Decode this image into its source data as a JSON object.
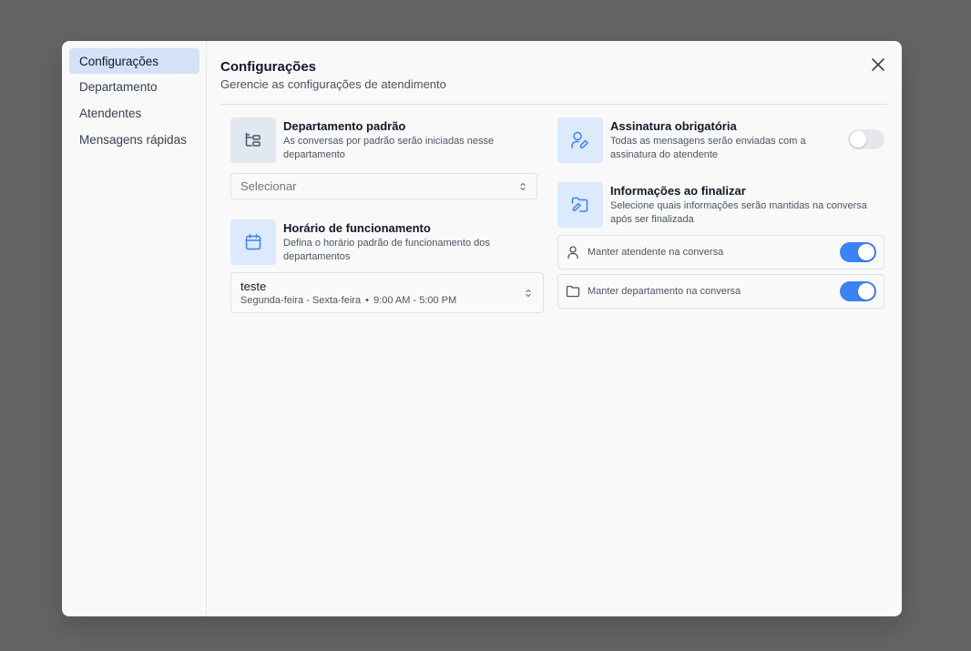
{
  "sidebar": {
    "items": [
      {
        "label": "Configurações"
      },
      {
        "label": "Departamento"
      },
      {
        "label": "Atendentes"
      },
      {
        "label": "Mensagens rápidas"
      }
    ]
  },
  "header": {
    "title": "Configurações",
    "subtitle": "Gerencie as configurações de atendimento"
  },
  "default_department": {
    "title": "Departamento padrão",
    "description": "As conversas por padrão serão iniciadas nesse departamento",
    "select_placeholder": "Selecionar",
    "icon": "department-tree-icon"
  },
  "business_hours": {
    "title": "Horário de funcionamento",
    "description": "Defina o horário padrão de funcionamento dos departamentos",
    "selected_name": "teste",
    "selected_days": "Segunda-feira - Sexta-feira",
    "separator": "•",
    "selected_hours": "9:00 AM - 5:00 PM",
    "icon": "calendar-icon"
  },
  "signature": {
    "title": "Assinatura obrigatória",
    "description": "Todas as mensagens serão enviadas com a assinatura do atendente",
    "enabled": false,
    "icon": "user-pen-icon"
  },
  "finalize_info": {
    "title": "Informações ao finalizar",
    "description": "Selecione quais informações serão mantidas na conversa após ser finalizada",
    "icon": "folder-pen-icon",
    "options": [
      {
        "label": "Manter atendente na conversa",
        "icon": "user-icon",
        "enabled": true
      },
      {
        "label": "Manter departamento na conversa",
        "icon": "folder-icon",
        "enabled": true
      }
    ]
  },
  "colors": {
    "accent": "#3b82f6",
    "active_nav": "#d3e2f6",
    "icon_blue": "#3b82f6"
  }
}
